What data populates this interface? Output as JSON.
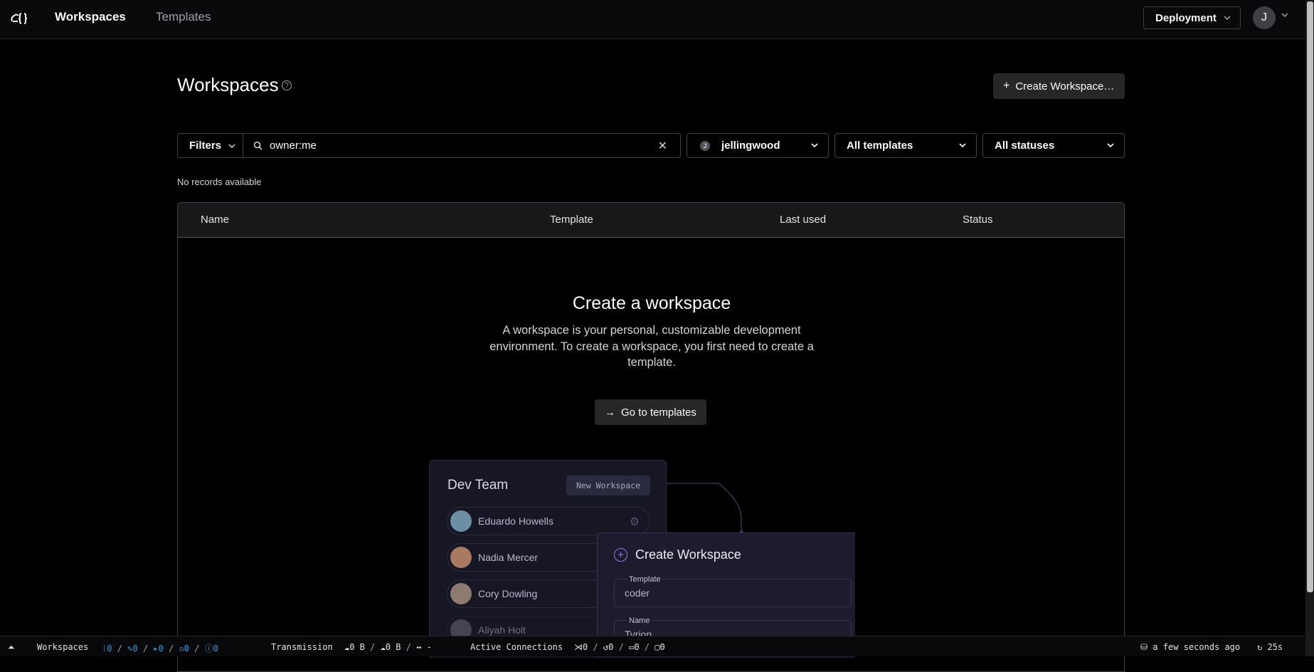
{
  "nav": {
    "links": [
      "Workspaces",
      "Templates"
    ],
    "deployment_label": "Deployment",
    "user_initial": "J"
  },
  "page": {
    "title": "Workspaces",
    "create_label": "Create Workspace…"
  },
  "filters": {
    "filters_label": "Filters",
    "search_value": "owner:me",
    "user_initial": "J",
    "user_select": "jellingwood",
    "template_select": "All templates",
    "status_select": "All statuses",
    "no_records": "No records available"
  },
  "table": {
    "columns": [
      "Name",
      "Template",
      "Last used",
      "Status"
    ]
  },
  "empty_state": {
    "title": "Create a workspace",
    "description": "A workspace is your personal, customizable development environment. To create a workspace, you first need to create a template.",
    "button_label": "Go to templates"
  },
  "illustration": {
    "team_title": "Dev Team",
    "new_workspace_badge": "New Workspace",
    "members": [
      "Eduardo Howells",
      "Nadia Mercer",
      "Cory Dowling",
      "Aliyah Holt"
    ],
    "create_title": "Create Workspace",
    "fields": [
      {
        "label": "Template",
        "value": "coder"
      },
      {
        "label": "Name",
        "value": "Tyrion"
      }
    ]
  },
  "statusbar": {
    "workspaces_label": "Workspaces",
    "counts": [
      "0",
      "0",
      "0",
      "0",
      "0"
    ],
    "transmission_label": "Transmission",
    "upload": "0 B",
    "download": "0 B",
    "latency": "-",
    "active_connections_label": "Active Connections",
    "conn_counts": [
      "0",
      "0",
      "0",
      "0"
    ],
    "last_updated": "a few seconds ago",
    "refresh_interval": "25s"
  },
  "colors": {
    "background": "#000000",
    "navbar": "#09090b",
    "border": "#3f3f46",
    "accent_blue": "#3b9ae1",
    "accent_purple": "#8b7fe0"
  }
}
